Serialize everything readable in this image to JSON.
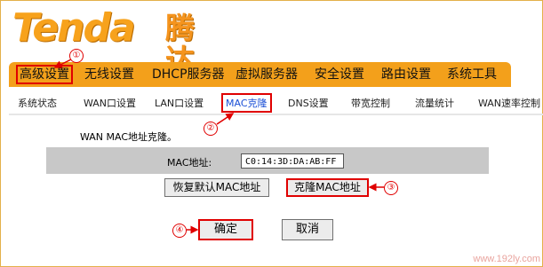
{
  "brand": {
    "logo_text": "Tenda",
    "logo_cn": "腾达"
  },
  "main_nav": [
    {
      "label": "高级设置",
      "active": true
    },
    {
      "label": "无线设置"
    },
    {
      "label": "DHCP服务器"
    },
    {
      "label": "虚拟服务器"
    },
    {
      "label": "安全设置"
    },
    {
      "label": "路由设置"
    },
    {
      "label": "系统工具"
    }
  ],
  "sub_nav": [
    {
      "label": "系统状态"
    },
    {
      "label": "WAN口设置"
    },
    {
      "label": "LAN口设置"
    },
    {
      "label": "MAC克隆",
      "active": true
    },
    {
      "label": "DNS设置"
    },
    {
      "label": "带宽控制"
    },
    {
      "label": "流量统计"
    },
    {
      "label": "WAN速率控制"
    }
  ],
  "content": {
    "description": "WAN MAC地址克隆。",
    "mac_label": "MAC地址:",
    "mac_value": "C0:14:3D:DA:AB:FF",
    "restore_button": "恢复默认MAC地址",
    "clone_button": "克隆MAC地址",
    "ok_button": "确定",
    "cancel_button": "取消"
  },
  "markers": [
    "①",
    "②",
    "③",
    "④"
  ],
  "watermark": "www.192ly.com",
  "colors": {
    "nav_orange": "#f3a01b",
    "highlight_red": "#e00000",
    "active_blue": "#1a4fd6"
  }
}
